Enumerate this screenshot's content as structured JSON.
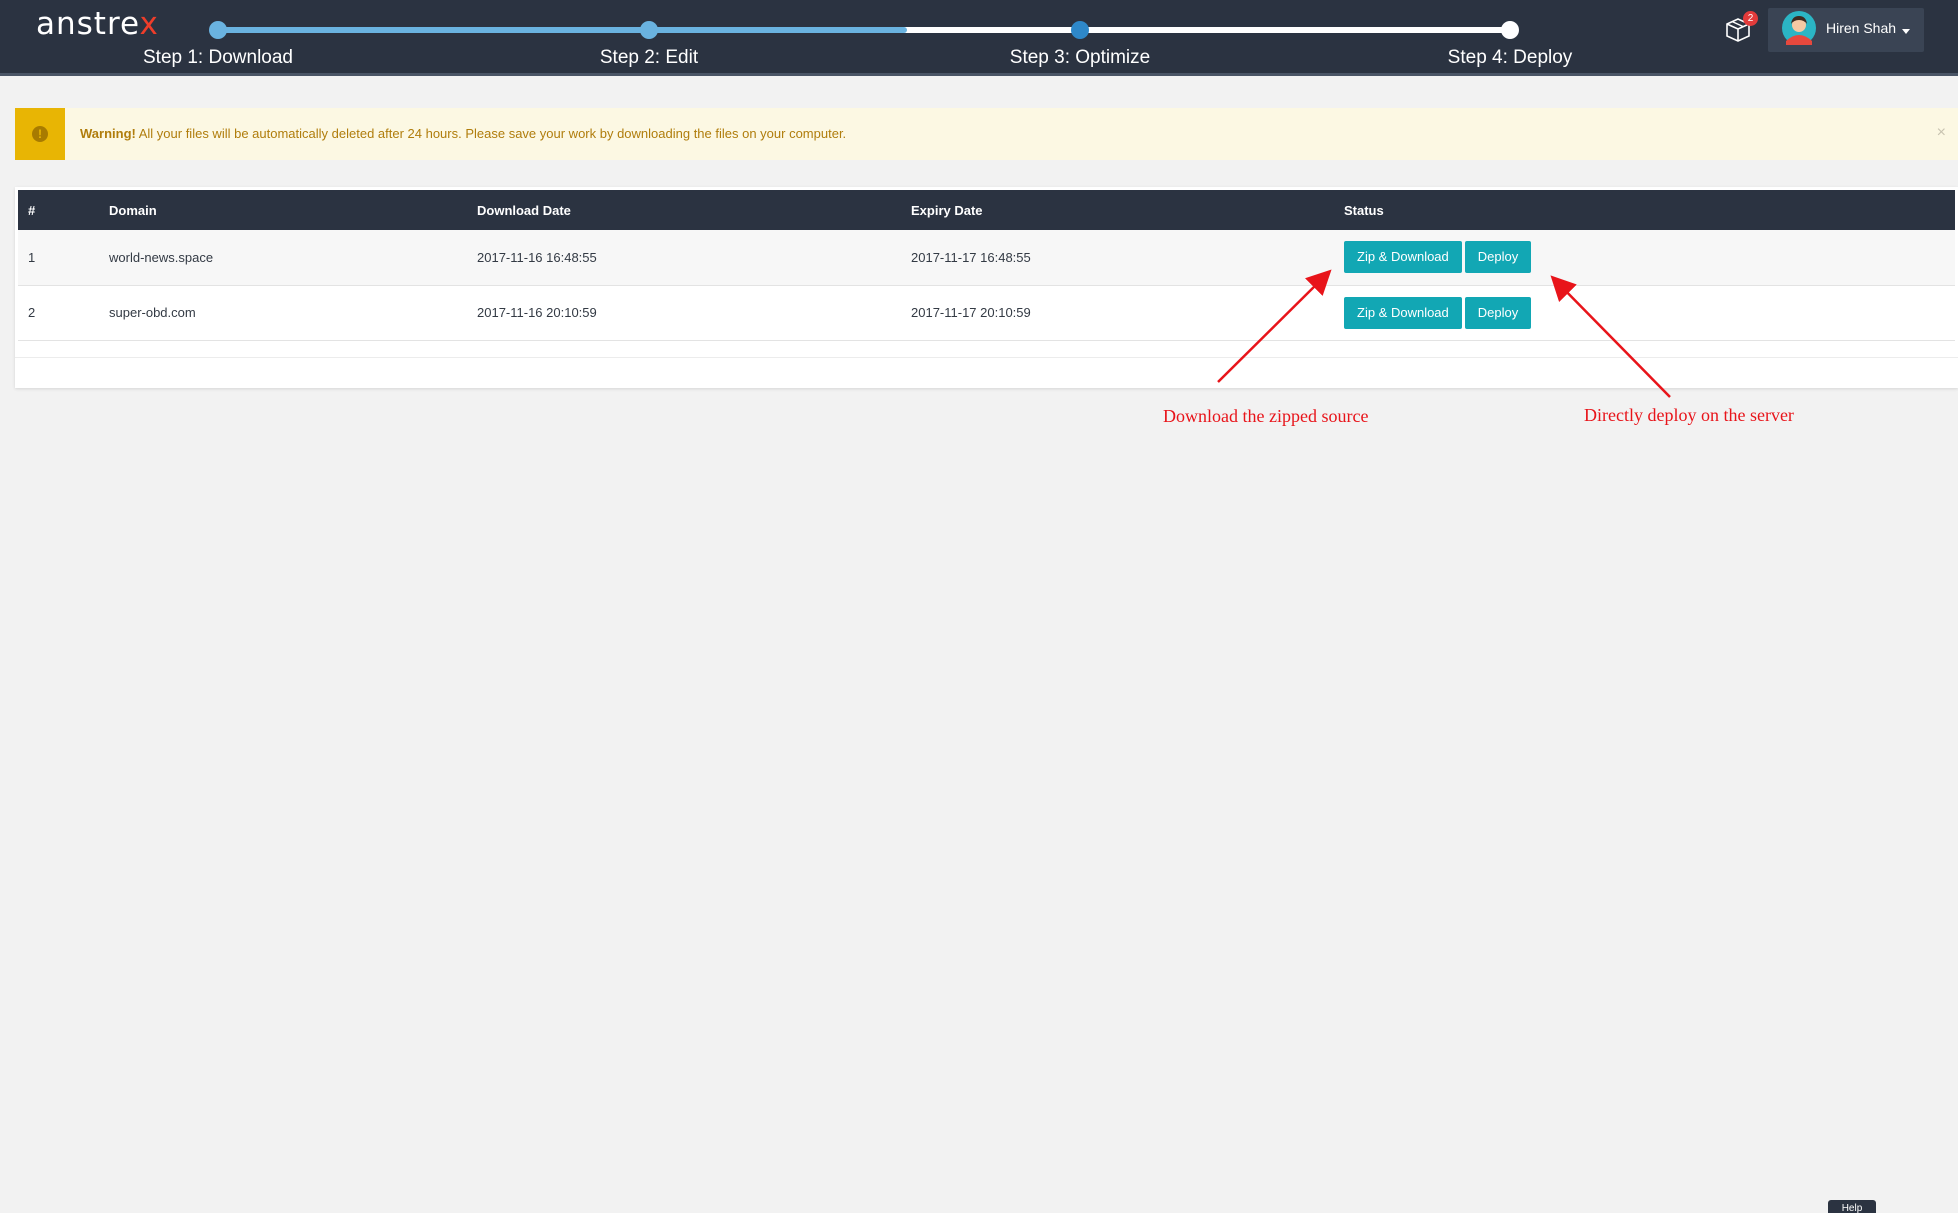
{
  "header": {
    "logo_main": "anstre",
    "logo_accent": "x",
    "notification_count": "2",
    "user_name": "Hiren Shah"
  },
  "stepper": {
    "progress_fraction": 0.533,
    "steps": [
      {
        "label": "Step 1: Download",
        "state": "done"
      },
      {
        "label": "Step 2: Edit",
        "state": "done"
      },
      {
        "label": "Step 3: Optimize",
        "state": "active"
      },
      {
        "label": "Step 4: Deploy",
        "state": "pending"
      }
    ]
  },
  "alert": {
    "strong": "Warning!",
    "message": " All your files will be automatically deleted after 24 hours. Please save your work by downloading the files on your computer.",
    "icon": "exclamation-circle-icon",
    "close": "×"
  },
  "table": {
    "headers": [
      "#",
      "Domain",
      "Download Date",
      "Expiry Date",
      "Status"
    ],
    "rows": [
      {
        "index": "1",
        "domain": "world-news.space",
        "download_date": "2017-11-16 16:48:55",
        "expiry_date": "2017-11-17 16:48:55",
        "zip_label": "Zip & Download",
        "deploy_label": "Deploy"
      },
      {
        "index": "2",
        "domain": "super-obd.com",
        "download_date": "2017-11-16 20:10:59",
        "expiry_date": "2017-11-17 20:10:59",
        "zip_label": "Zip & Download",
        "deploy_label": "Deploy"
      }
    ]
  },
  "annotations": {
    "zip_note": "Download the zipped source",
    "deploy_note": "Directly deploy on the server"
  },
  "help_label": "Help",
  "colors": {
    "header_bg": "#2b3341",
    "step_done": "#6ab3e0",
    "step_active": "#2e88c9",
    "button": "#12a7b4",
    "warning_bg": "#fcf8e3",
    "warning_icon_bg": "#e8b504",
    "annotation": "#e8141a"
  }
}
